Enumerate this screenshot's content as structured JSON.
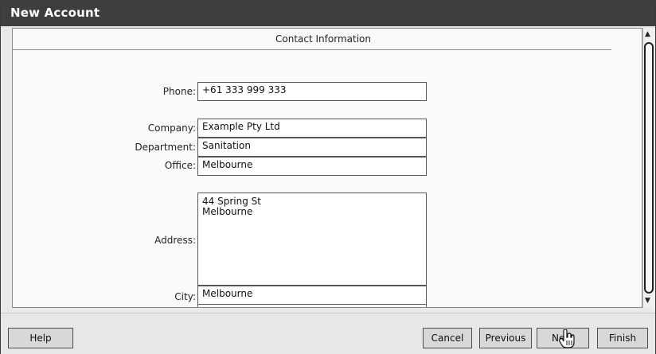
{
  "window": {
    "title": "New Account"
  },
  "section": {
    "title": "Contact Information"
  },
  "fields": {
    "phone": {
      "label": "Phone:",
      "value": "+61 333 999 333"
    },
    "company": {
      "label": "Company:",
      "value": "Example Pty Ltd"
    },
    "department": {
      "label": "Department:",
      "value": "Sanitation"
    },
    "office": {
      "label": "Office:",
      "value": "Melbourne"
    },
    "address": {
      "label": "Address:",
      "value": "44 Spring St\nMelbourne"
    },
    "city": {
      "label": "City:",
      "value": "Melbourne"
    }
  },
  "scrollbar": {
    "up_icon": "▲",
    "down_icon": "▼"
  },
  "buttons": {
    "help": "Help",
    "cancel": "Cancel",
    "previous": "Previous",
    "next": "Next",
    "finish": "Finish"
  }
}
